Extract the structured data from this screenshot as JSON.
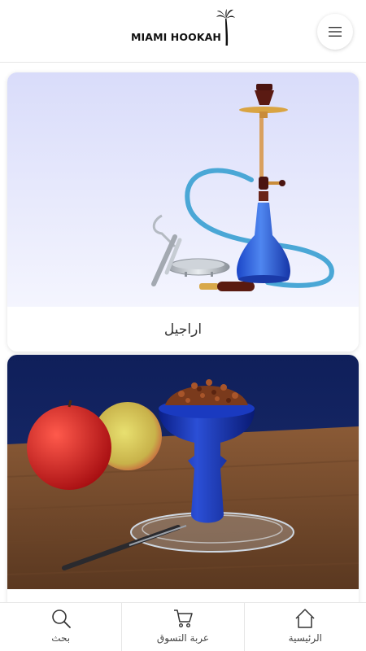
{
  "header": {
    "logo_text": "MIAMI HOOKAH",
    "menu_icon": "hamburger-menu-icon"
  },
  "categories": [
    {
      "label": "اراجيل",
      "image": "hookah-set-image"
    },
    {
      "label": "",
      "image": "hookah-bowl-tobacco-image"
    }
  ],
  "bottom_nav": {
    "search": {
      "label": "بحث",
      "icon": "search-icon"
    },
    "cart": {
      "label": "عربة التسوق",
      "icon": "cart-icon"
    },
    "home": {
      "label": "الرئيسية",
      "icon": "home-icon"
    }
  }
}
